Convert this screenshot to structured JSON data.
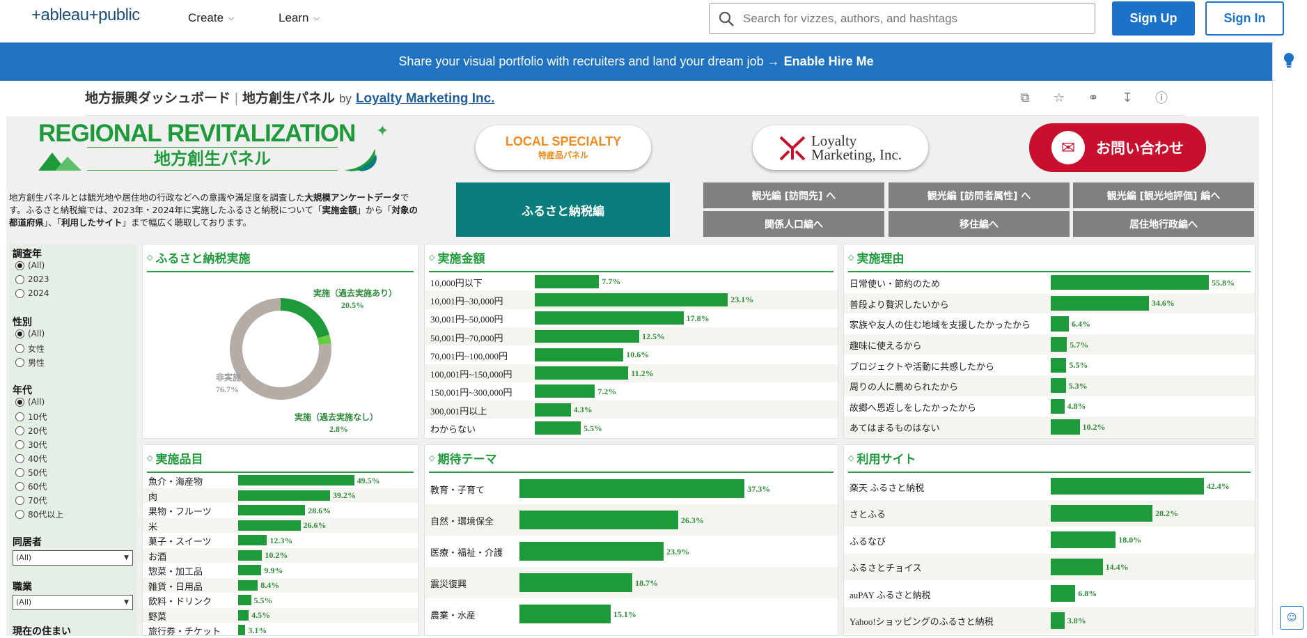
{
  "nav": {
    "logo": "+ableau+public",
    "create": "Create",
    "learn": "Learn",
    "search_placeholder": "Search for vizzes, authors, and hashtags",
    "signup": "Sign Up",
    "signin": "Sign In"
  },
  "banner": {
    "text": "Share your visual portfolio with recruiters and land your dream job →",
    "cta": "Enable Hire Me"
  },
  "viz": {
    "title1": "地方振興ダッシュボード",
    "title2": "地方創生パネル",
    "by": "by",
    "author": "Loyalty Marketing Inc."
  },
  "dashboard": {
    "brand_title": "REGIONAL REVITALIZATION",
    "brand_sub": "地方創生パネル",
    "local_l1": "LOCAL SPECIALTY",
    "local_l2": "特産品パネル",
    "loyalty_l1": "Loyalty",
    "loyalty_l2": "Marketing, Inc.",
    "contact": "お問い合わせ",
    "intro_a": "地方創生パネルとは観光地や居住地の行政などへの意識や満足度を調査した",
    "intro_b": "大規模アンケートデータ",
    "intro_c": "です。ふるさと納税編では、2023年・2024年に実施したふるさと納税について「",
    "intro_d": "実施金額",
    "intro_e": "」から「",
    "intro_f": "対象の都道府県",
    "intro_g": "」、「",
    "intro_h": "利用したサイト",
    "intro_i": "」まで幅広く聴取しております。",
    "active_tab": "ふるさと納税編",
    "tabs": [
      "観光編 [訪問先] へ",
      "観光編 [訪問者属性] へ",
      "観光編 [観光地評価] 編へ",
      "関係人口編へ",
      "移住編へ",
      "居住地行政編へ"
    ]
  },
  "filters": {
    "year_label": "調査年",
    "year_options": [
      "(All)",
      "2023",
      "2024"
    ],
    "gender_label": "性別",
    "gender_options": [
      "(All)",
      "女性",
      "男性"
    ],
    "age_label": "年代",
    "age_options": [
      "(All)",
      "10代",
      "20代",
      "30代",
      "40代",
      "50代",
      "60代",
      "70代",
      "80代以上"
    ],
    "household_label": "同居者",
    "household_value": "(All)",
    "job_label": "職業",
    "job_value": "(All)",
    "residence_label": "現在の住まい"
  },
  "colors": {
    "bar": "#1e9a3a",
    "donut_grey": "#b5aca6",
    "teal": "#0a7d7d",
    "banner": "#1f73c1",
    "contact": "#c8102e"
  },
  "chart_data": [
    {
      "type": "pie",
      "title": "ふるさと納税実施",
      "categories": [
        "実施（過去実施あり）",
        "実施（過去実施なし）",
        "非実施"
      ],
      "values": [
        20.5,
        2.8,
        76.7
      ],
      "labels": [
        "20.5%",
        "2.8%",
        "76.7%"
      ]
    },
    {
      "type": "bar",
      "title": "実施金額",
      "categories": [
        "10,000円以下",
        "10,001円~30,000円",
        "30,001円~50,000円",
        "50,001円~70,000円",
        "70,001円~100,000円",
        "100,001円~150,000円",
        "150,001円~300,000円",
        "300,001円以上",
        "わからない"
      ],
      "values": [
        7.7,
        23.1,
        17.8,
        12.5,
        10.6,
        11.2,
        7.2,
        4.3,
        5.5
      ],
      "labels": [
        "7.7%",
        "23.1%",
        "17.8%",
        "12.5%",
        "10.6%",
        "11.2%",
        "7.2%",
        "4.3%",
        "5.5%"
      ]
    },
    {
      "type": "bar",
      "title": "実施理由",
      "categories": [
        "日常使い・節約のため",
        "普段より贅沢したいから",
        "家族や友人の住む地域を支援したかったから",
        "趣味に使えるから",
        "プロジェクトや活動に共感したから",
        "周りの人に薦められたから",
        "故郷へ恩返しをしたかったから",
        "あてはまるものはない"
      ],
      "values": [
        55.8,
        34.6,
        6.4,
        5.7,
        5.5,
        5.3,
        4.8,
        10.2
      ],
      "labels": [
        "55.8%",
        "34.6%",
        "6.4%",
        "5.7%",
        "5.5%",
        "5.3%",
        "4.8%",
        "10.2%"
      ]
    },
    {
      "type": "bar",
      "title": "実施品目",
      "categories": [
        "魚介・海産物",
        "肉",
        "果物・フルーツ",
        "米",
        "菓子・スイーツ",
        "お酒",
        "惣菜・加工品",
        "雑貨・日用品",
        "飲料・ドリンク",
        "野菜",
        "旅行券・チケット"
      ],
      "values": [
        49.5,
        39.2,
        28.6,
        26.6,
        12.3,
        10.2,
        9.9,
        8.4,
        5.5,
        4.5,
        3.1
      ],
      "labels": [
        "49.5%",
        "39.2%",
        "28.6%",
        "26.6%",
        "12.3%",
        "10.2%",
        "9.9%",
        "8.4%",
        "5.5%",
        "4.5%",
        "3.1%"
      ]
    },
    {
      "type": "bar",
      "title": "期待テーマ",
      "categories": [
        "教育・子育て",
        "自然・環境保全",
        "医療・福祉・介護",
        "震災復興",
        "農業・水産"
      ],
      "values": [
        37.3,
        26.3,
        23.9,
        18.7,
        15.1
      ],
      "labels": [
        "37.3%",
        "26.3%",
        "23.9%",
        "18.7%",
        "15.1%"
      ]
    },
    {
      "type": "bar",
      "title": "利用サイト",
      "categories": [
        "楽天 ふるさと納税",
        "さとふる",
        "ふるなび",
        "ふるさとチョイス",
        "auPAY ふるさと納税",
        "Yahoo!ショッピングのふるさと納税"
      ],
      "values": [
        42.4,
        28.2,
        18.0,
        14.4,
        6.8,
        3.8
      ],
      "labels": [
        "42.4%",
        "28.2%",
        "18.0%",
        "14.4%",
        "6.8%",
        "3.8%"
      ]
    }
  ]
}
